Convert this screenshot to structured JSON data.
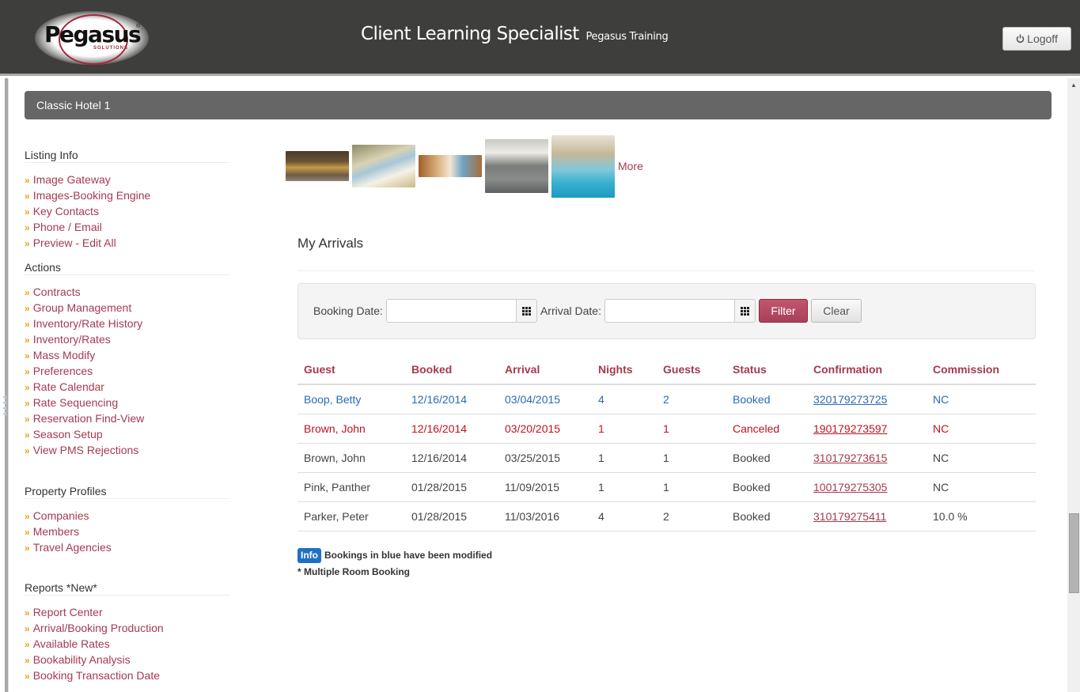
{
  "header": {
    "logo": {
      "name": "Pegasus",
      "registered": "®",
      "tagline": "SOLUTIONS"
    },
    "title": "Client Learning Specialist",
    "subtitle": "Pegasus Training",
    "logoff_label": "Logoff",
    "logoff_icon": "power-icon"
  },
  "hotel": {
    "name": "Classic Hotel  1"
  },
  "sidebar": {
    "sections": [
      {
        "heading": "Listing Info",
        "items": [
          "Image Gateway",
          "Images-Booking Engine",
          "Key Contacts",
          "Phone / Email",
          "Preview - Edit All"
        ]
      },
      {
        "heading": "Actions",
        "items": [
          "Contracts",
          "Group Management",
          "Inventory/Rate History",
          "Inventory/Rates",
          "Mass Modify",
          "Preferences",
          "Rate Calendar",
          "Rate Sequencing",
          "Reservation Find-View",
          "Season Setup",
          "View PMS Rejections"
        ]
      },
      {
        "heading": "Property Profiles",
        "items": [
          "Companies",
          "Members",
          "Travel Agencies"
        ]
      },
      {
        "heading": "Reports *New*",
        "items": [
          "Report Center",
          "Arrival/Booking Production",
          "Available Rates",
          "Bookability Analysis",
          "Booking Transaction Date"
        ]
      }
    ],
    "bullet": "»"
  },
  "gallery": {
    "images": [
      "hotel-exterior",
      "guest-room-bed",
      "guest-room-twin",
      "fitness-center",
      "indoor-pool"
    ],
    "more_label": "More"
  },
  "arrivals": {
    "title": "My Arrivals",
    "filter": {
      "booking_date_label": "Booking Date:",
      "booking_date_value": "",
      "arrival_date_label": "Arrival Date:",
      "arrival_date_value": "",
      "filter_label": "Filter",
      "clear_label": "Clear"
    },
    "columns": [
      "Guest",
      "Booked",
      "Arrival",
      "Nights",
      "Guests",
      "Status",
      "Confirmation",
      "Commission"
    ],
    "rows": [
      {
        "state": "modified",
        "guest": "Boop, Betty",
        "booked": "12/16/2014",
        "arrival": "03/04/2015",
        "nights": "4",
        "guests": "2",
        "status": "Booked",
        "confirmation": "320179273725",
        "commission": "NC"
      },
      {
        "state": "canceled",
        "guest": "Brown, John",
        "booked": "12/16/2014",
        "arrival": "03/20/2015",
        "nights": "1",
        "guests": "1",
        "status": "Canceled",
        "confirmation": "190179273597",
        "commission": "NC"
      },
      {
        "state": "normal",
        "guest": "Brown, John",
        "booked": "12/16/2014",
        "arrival": "03/25/2015",
        "nights": "1",
        "guests": "1",
        "status": "Booked",
        "confirmation": "310179273615",
        "commission": "NC"
      },
      {
        "state": "normal",
        "guest": "Pink, Panther",
        "booked": "01/28/2015",
        "arrival": "11/09/2015",
        "nights": "1",
        "guests": "1",
        "status": "Booked",
        "confirmation": "100179275305",
        "commission": "NC"
      },
      {
        "state": "normal",
        "guest": "Parker, Peter",
        "booked": "01/28/2015",
        "arrival": "11/03/2016",
        "nights": "4",
        "guests": "2",
        "status": "Booked",
        "confirmation": "310179275411",
        "commission": "10.0 %"
      }
    ],
    "notes": {
      "info_badge": "Info",
      "info_text": "Bookings in blue have been modified",
      "multi_room": "* Multiple Room Booking"
    }
  },
  "colors": {
    "brand": "#a53a4d",
    "header_bg": "#3e3e3c",
    "modified": "#2b69b8",
    "canceled": "#c0121f",
    "bullet": "#f0a020",
    "info": "#1f6fc6"
  }
}
